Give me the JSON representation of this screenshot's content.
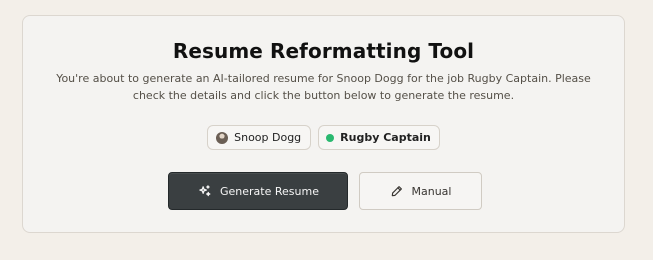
{
  "header": {
    "title": "Resume Reformatting Tool",
    "subtitle": "You're about to generate an AI-tailored resume for Snoop Dogg for the job Rugby Captain. Please check the details and click the button below to generate the resume."
  },
  "chips": {
    "candidate": {
      "name": "Snoop Dogg",
      "icon": "avatar"
    },
    "job": {
      "label": "Rugby Captain",
      "status_color": "#2ab970",
      "icon": "status-dot"
    }
  },
  "actions": {
    "generate": {
      "label": "Generate Resume",
      "icon": "sparkles-icon"
    },
    "manual": {
      "label": "Manual",
      "icon": "pencil-icon"
    }
  },
  "colors": {
    "background": "#f3efe9",
    "card": "#f4f3f1",
    "primary_button": "#3a3f41",
    "accent": "#2ab970"
  }
}
